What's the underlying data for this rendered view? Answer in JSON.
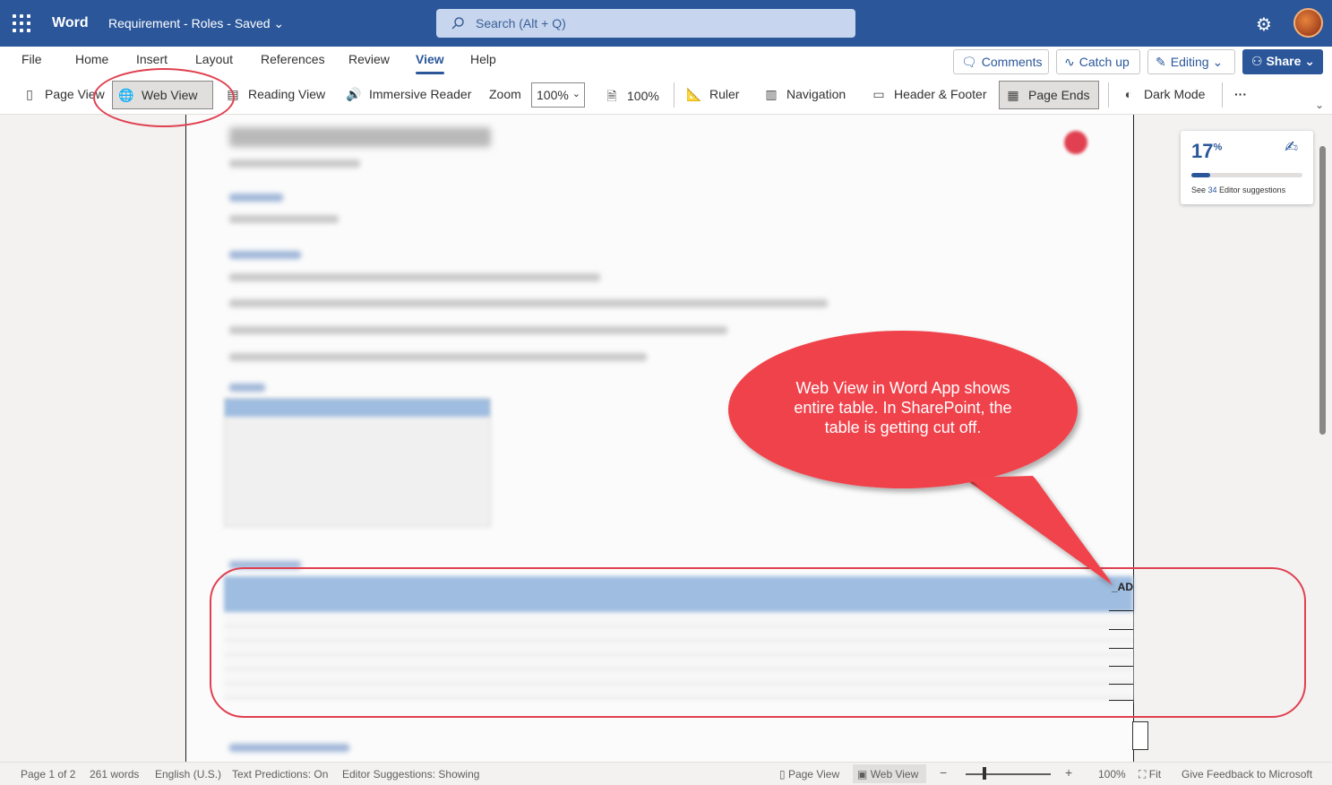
{
  "app": {
    "name": "Word",
    "doc_title": "Requirement - Roles  -  Saved ⌄",
    "search_placeholder": "Search (Alt + Q)"
  },
  "tabs": [
    {
      "label": "File"
    },
    {
      "label": "Home"
    },
    {
      "label": "Insert"
    },
    {
      "label": "Layout"
    },
    {
      "label": "References"
    },
    {
      "label": "Review"
    },
    {
      "label": "View",
      "active": true
    },
    {
      "label": "Help"
    }
  ],
  "top_buttons": {
    "comments": "Comments",
    "catch_up": "Catch up",
    "editing": "Editing",
    "share": "Share"
  },
  "ribbon": {
    "page_view": "Page View",
    "web_view": "Web View",
    "reading_view": "Reading View",
    "immersive_reader": "Immersive Reader",
    "zoom_label": "Zoom",
    "zoom_value": "100%",
    "zoom_100": "100%",
    "ruler": "Ruler",
    "navigation": "Navigation",
    "header_footer": "Header & Footer",
    "page_ends": "Page Ends",
    "dark_mode": "Dark Mode",
    "more": "···"
  },
  "editor": {
    "score": "17",
    "score_unit": "%",
    "score_fraction": 0.17,
    "see": "See ",
    "count": "34",
    "suffix": " Editor suggestions"
  },
  "document": {
    "cut_label": "_AD"
  },
  "callout": {
    "text": "Web View in Word App shows\nentire table.  In SharePoint, the\ntable is getting cut off."
  },
  "status": {
    "page": "Page 1 of 2",
    "words": "261 words",
    "language": "English (U.S.)",
    "predictions": "Text Predictions: On",
    "suggestions": "Editor Suggestions: Showing",
    "page_view": "Page View",
    "web_view": "Web View",
    "zoom": "100%",
    "fit": "Fit",
    "feedback": "Give Feedback to Microsoft"
  },
  "colors": {
    "brand": "#2b579a",
    "annotation": "#e04050"
  }
}
